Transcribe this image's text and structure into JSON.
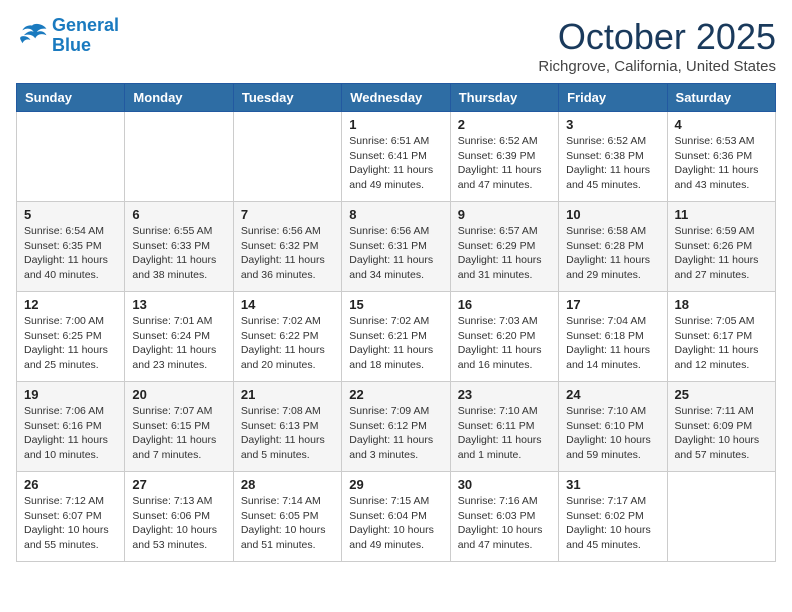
{
  "header": {
    "logo_line1": "General",
    "logo_line2": "Blue",
    "month": "October 2025",
    "location": "Richgrove, California, United States"
  },
  "weekdays": [
    "Sunday",
    "Monday",
    "Tuesday",
    "Wednesday",
    "Thursday",
    "Friday",
    "Saturday"
  ],
  "weeks": [
    [
      {
        "day": "",
        "info": ""
      },
      {
        "day": "",
        "info": ""
      },
      {
        "day": "",
        "info": ""
      },
      {
        "day": "1",
        "info": "Sunrise: 6:51 AM\nSunset: 6:41 PM\nDaylight: 11 hours\nand 49 minutes."
      },
      {
        "day": "2",
        "info": "Sunrise: 6:52 AM\nSunset: 6:39 PM\nDaylight: 11 hours\nand 47 minutes."
      },
      {
        "day": "3",
        "info": "Sunrise: 6:52 AM\nSunset: 6:38 PM\nDaylight: 11 hours\nand 45 minutes."
      },
      {
        "day": "4",
        "info": "Sunrise: 6:53 AM\nSunset: 6:36 PM\nDaylight: 11 hours\nand 43 minutes."
      }
    ],
    [
      {
        "day": "5",
        "info": "Sunrise: 6:54 AM\nSunset: 6:35 PM\nDaylight: 11 hours\nand 40 minutes."
      },
      {
        "day": "6",
        "info": "Sunrise: 6:55 AM\nSunset: 6:33 PM\nDaylight: 11 hours\nand 38 minutes."
      },
      {
        "day": "7",
        "info": "Sunrise: 6:56 AM\nSunset: 6:32 PM\nDaylight: 11 hours\nand 36 minutes."
      },
      {
        "day": "8",
        "info": "Sunrise: 6:56 AM\nSunset: 6:31 PM\nDaylight: 11 hours\nand 34 minutes."
      },
      {
        "day": "9",
        "info": "Sunrise: 6:57 AM\nSunset: 6:29 PM\nDaylight: 11 hours\nand 31 minutes."
      },
      {
        "day": "10",
        "info": "Sunrise: 6:58 AM\nSunset: 6:28 PM\nDaylight: 11 hours\nand 29 minutes."
      },
      {
        "day": "11",
        "info": "Sunrise: 6:59 AM\nSunset: 6:26 PM\nDaylight: 11 hours\nand 27 minutes."
      }
    ],
    [
      {
        "day": "12",
        "info": "Sunrise: 7:00 AM\nSunset: 6:25 PM\nDaylight: 11 hours\nand 25 minutes."
      },
      {
        "day": "13",
        "info": "Sunrise: 7:01 AM\nSunset: 6:24 PM\nDaylight: 11 hours\nand 23 minutes."
      },
      {
        "day": "14",
        "info": "Sunrise: 7:02 AM\nSunset: 6:22 PM\nDaylight: 11 hours\nand 20 minutes."
      },
      {
        "day": "15",
        "info": "Sunrise: 7:02 AM\nSunset: 6:21 PM\nDaylight: 11 hours\nand 18 minutes."
      },
      {
        "day": "16",
        "info": "Sunrise: 7:03 AM\nSunset: 6:20 PM\nDaylight: 11 hours\nand 16 minutes."
      },
      {
        "day": "17",
        "info": "Sunrise: 7:04 AM\nSunset: 6:18 PM\nDaylight: 11 hours\nand 14 minutes."
      },
      {
        "day": "18",
        "info": "Sunrise: 7:05 AM\nSunset: 6:17 PM\nDaylight: 11 hours\nand 12 minutes."
      }
    ],
    [
      {
        "day": "19",
        "info": "Sunrise: 7:06 AM\nSunset: 6:16 PM\nDaylight: 11 hours\nand 10 minutes."
      },
      {
        "day": "20",
        "info": "Sunrise: 7:07 AM\nSunset: 6:15 PM\nDaylight: 11 hours\nand 7 minutes."
      },
      {
        "day": "21",
        "info": "Sunrise: 7:08 AM\nSunset: 6:13 PM\nDaylight: 11 hours\nand 5 minutes."
      },
      {
        "day": "22",
        "info": "Sunrise: 7:09 AM\nSunset: 6:12 PM\nDaylight: 11 hours\nand 3 minutes."
      },
      {
        "day": "23",
        "info": "Sunrise: 7:10 AM\nSunset: 6:11 PM\nDaylight: 11 hours\nand 1 minute."
      },
      {
        "day": "24",
        "info": "Sunrise: 7:10 AM\nSunset: 6:10 PM\nDaylight: 10 hours\nand 59 minutes."
      },
      {
        "day": "25",
        "info": "Sunrise: 7:11 AM\nSunset: 6:09 PM\nDaylight: 10 hours\nand 57 minutes."
      }
    ],
    [
      {
        "day": "26",
        "info": "Sunrise: 7:12 AM\nSunset: 6:07 PM\nDaylight: 10 hours\nand 55 minutes."
      },
      {
        "day": "27",
        "info": "Sunrise: 7:13 AM\nSunset: 6:06 PM\nDaylight: 10 hours\nand 53 minutes."
      },
      {
        "day": "28",
        "info": "Sunrise: 7:14 AM\nSunset: 6:05 PM\nDaylight: 10 hours\nand 51 minutes."
      },
      {
        "day": "29",
        "info": "Sunrise: 7:15 AM\nSunset: 6:04 PM\nDaylight: 10 hours\nand 49 minutes."
      },
      {
        "day": "30",
        "info": "Sunrise: 7:16 AM\nSunset: 6:03 PM\nDaylight: 10 hours\nand 47 minutes."
      },
      {
        "day": "31",
        "info": "Sunrise: 7:17 AM\nSunset: 6:02 PM\nDaylight: 10 hours\nand 45 minutes."
      },
      {
        "day": "",
        "info": ""
      }
    ]
  ]
}
